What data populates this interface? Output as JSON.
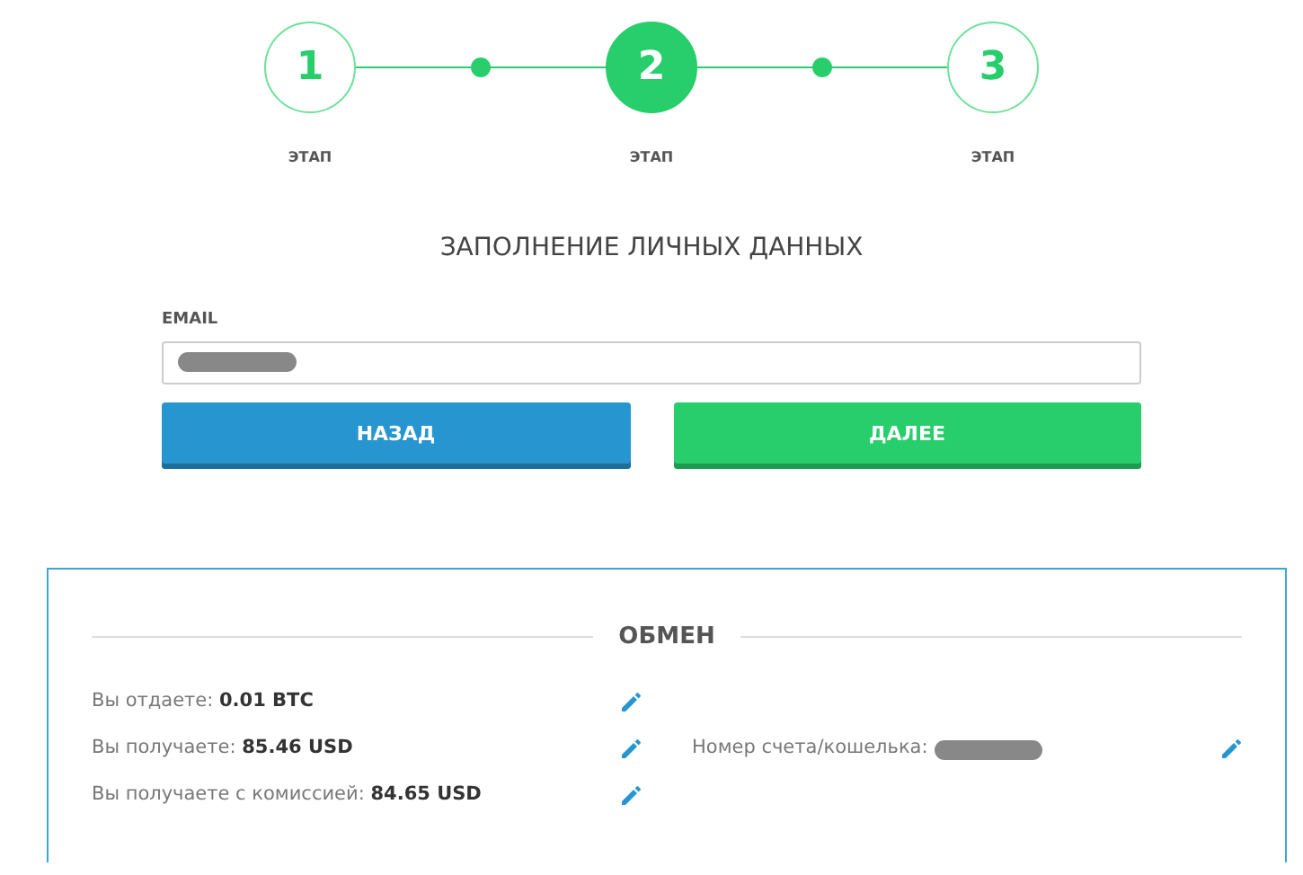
{
  "steps": [
    {
      "number": "1",
      "label": "ЭТАП",
      "selected": false
    },
    {
      "number": "2",
      "label": "ЭТАП",
      "selected": true
    },
    {
      "number": "3",
      "label": "ЭТАП",
      "selected": false
    }
  ],
  "form": {
    "title": "ЗАПОЛНЕНИЕ ЛИЧНЫХ ДАННЫХ",
    "email_label": "EMAIL",
    "buttons": [
      {
        "label": "НАЗАД",
        "kind": "back"
      },
      {
        "label": "ДАЛЕЕ",
        "kind": "next"
      }
    ]
  },
  "exchange": {
    "title": "ОБМЕН",
    "left": [
      {
        "label": "Вы отдаете:",
        "value": "0.01 BTC"
      },
      {
        "label": "Вы получаете:",
        "value": "85.46 USD"
      },
      {
        "label": "Вы получаете с комиссией:",
        "value": "84.65 USD"
      }
    ],
    "right": [
      {
        "label": "Номер счета/кошелька:"
      }
    ]
  }
}
